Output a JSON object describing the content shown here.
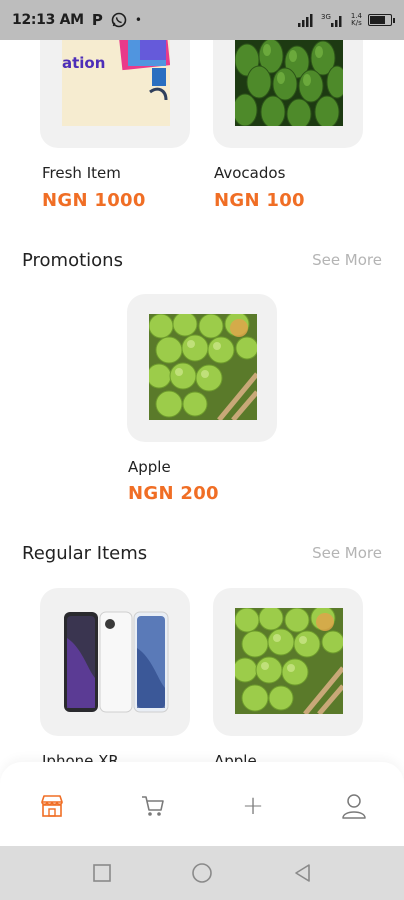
{
  "status_bar": {
    "time": "12:13 AM",
    "p_label": "P",
    "dot": "•",
    "net_speed_value": "1.4",
    "net_speed_unit": "K/s",
    "battery_level": 0.8
  },
  "top_items": [
    {
      "name": "Fresh Item",
      "price": "NGN 1000",
      "image": "promo-graphic"
    },
    {
      "name": "Avocados",
      "price": "NGN 100",
      "image": "avocados-photo"
    }
  ],
  "promotions": {
    "title": "Promotions",
    "see_more": "See More",
    "items": [
      {
        "name": "Apple",
        "price": "NGN 200",
        "image": "apples-photo"
      }
    ]
  },
  "regular_items": {
    "title": "Regular Items",
    "see_more": "See More",
    "items": [
      {
        "name": "Iphone XR",
        "image": "iphone-photo"
      },
      {
        "name": "Apple",
        "image": "apples-photo"
      }
    ]
  },
  "promo_graphic_text": "ation",
  "bottom_nav": {
    "active": "store",
    "items": [
      "store-icon",
      "cart-icon",
      "plus-icon",
      "user-icon"
    ],
    "plus_glyph": "+"
  },
  "colors": {
    "accent": "#f06e25",
    "card_bg": "#f1f1f1",
    "muted": "#b4b4b4"
  }
}
